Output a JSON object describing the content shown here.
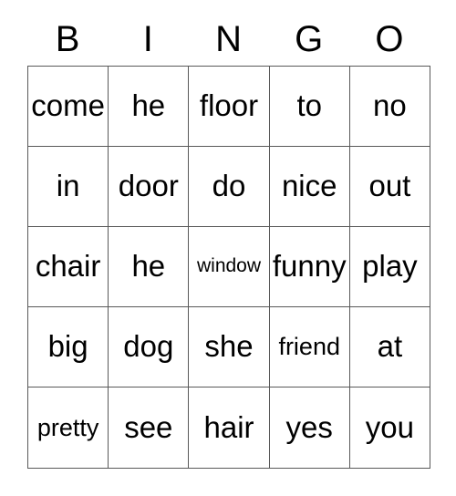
{
  "card": {
    "title": "BINGO",
    "header": {
      "letters": [
        "B",
        "I",
        "N",
        "G",
        "O"
      ]
    },
    "colors": {
      "grid_line": "#595959",
      "text": "#000000",
      "background": "#ffffff"
    },
    "grid": {
      "columns": 5,
      "rows": 5,
      "cells": [
        [
          {
            "word": "come",
            "size": "lg"
          },
          {
            "word": "he",
            "size": "lg"
          },
          {
            "word": "floor",
            "size": "lg"
          },
          {
            "word": "to",
            "size": "lg"
          },
          {
            "word": "no",
            "size": "lg"
          }
        ],
        [
          {
            "word": "in",
            "size": "lg"
          },
          {
            "word": "door",
            "size": "lg"
          },
          {
            "word": "do",
            "size": "lg"
          },
          {
            "word": "nice",
            "size": "lg"
          },
          {
            "word": "out",
            "size": "lg"
          }
        ],
        [
          {
            "word": "chair",
            "size": "lg"
          },
          {
            "word": "he",
            "size": "lg"
          },
          {
            "word": "window",
            "size": "sm"
          },
          {
            "word": "funny",
            "size": "lg"
          },
          {
            "word": "play",
            "size": "lg"
          }
        ],
        [
          {
            "word": "big",
            "size": "lg"
          },
          {
            "word": "dog",
            "size": "lg"
          },
          {
            "word": "she",
            "size": "lg"
          },
          {
            "word": "friend",
            "size": "md"
          },
          {
            "word": "at",
            "size": "lg"
          }
        ],
        [
          {
            "word": "pretty",
            "size": "md"
          },
          {
            "word": "see",
            "size": "lg"
          },
          {
            "word": "hair",
            "size": "lg"
          },
          {
            "word": "yes",
            "size": "lg"
          },
          {
            "word": "you",
            "size": "lg"
          }
        ]
      ]
    }
  }
}
